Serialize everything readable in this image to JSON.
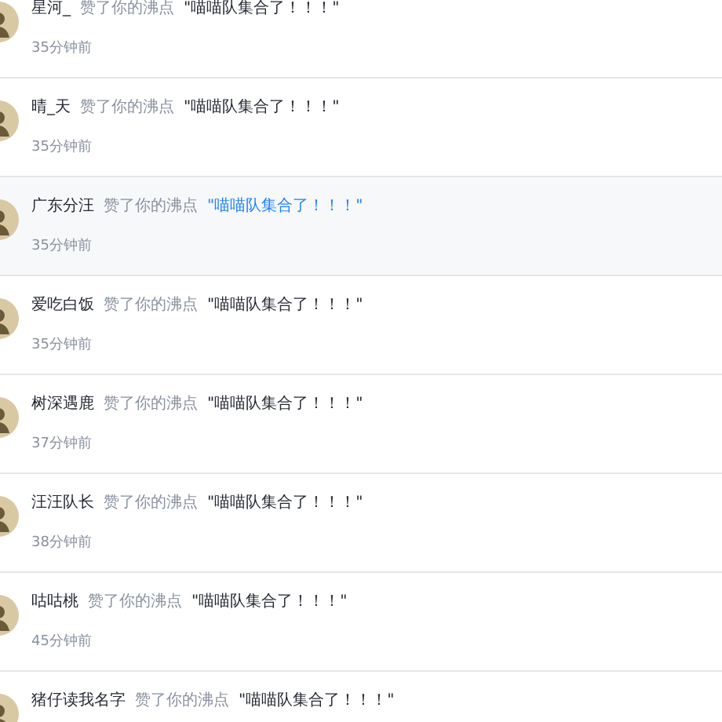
{
  "notifications": [
    {
      "user": "星河_",
      "action": "赞了你的沸点",
      "quote": "\"喵喵队集合了！！！\"",
      "time": "35分钟前",
      "selected": false
    },
    {
      "user": "晴_天",
      "action": "赞了你的沸点",
      "quote": "\"喵喵队集合了！！！\"",
      "time": "35分钟前",
      "selected": false
    },
    {
      "user": "广东分汪",
      "action": "赞了你的沸点",
      "quote": "\"喵喵队集合了！！！\"",
      "time": "35分钟前",
      "selected": true
    },
    {
      "user": "爱吃白饭",
      "action": "赞了你的沸点",
      "quote": "\"喵喵队集合了！！！\"",
      "time": "35分钟前",
      "selected": false
    },
    {
      "user": "树深遇鹿",
      "action": "赞了你的沸点",
      "quote": "\"喵喵队集合了！！！\"",
      "time": "37分钟前",
      "selected": false
    },
    {
      "user": "汪汪队长",
      "action": "赞了你的沸点",
      "quote": "\"喵喵队集合了！！！\"",
      "time": "38分钟前",
      "selected": false
    },
    {
      "user": "咕咕桃",
      "action": "赞了你的沸点",
      "quote": "\"喵喵队集合了！！！\"",
      "time": "45分钟前",
      "selected": false
    },
    {
      "user": "猪仔读我名字",
      "action": "赞了你的沸点",
      "quote": "\"喵喵队集合了！！！\"",
      "selected": false
    }
  ]
}
